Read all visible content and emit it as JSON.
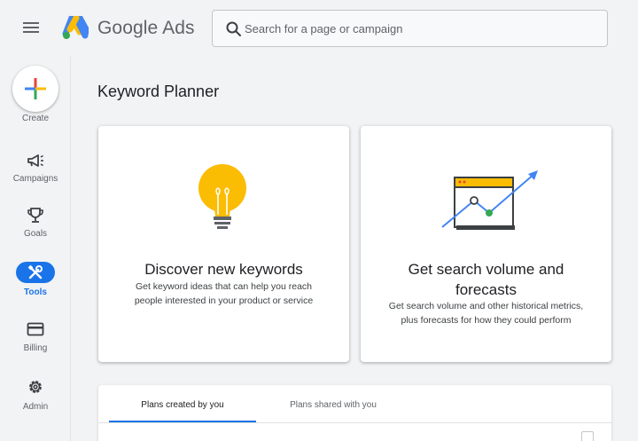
{
  "header": {
    "brand": "Google Ads",
    "search_placeholder": "Search for a page or campaign"
  },
  "sidebar": {
    "items": [
      {
        "label": "Create",
        "icon": "plus-icon"
      },
      {
        "label": "Campaigns",
        "icon": "megaphone-icon"
      },
      {
        "label": "Goals",
        "icon": "trophy-icon"
      },
      {
        "label": "Tools",
        "icon": "tools-icon",
        "active": true
      },
      {
        "label": "Billing",
        "icon": "credit-card-icon"
      },
      {
        "label": "Admin",
        "icon": "gear-icon"
      }
    ]
  },
  "main": {
    "title": "Keyword Planner",
    "cards": [
      {
        "title": "Discover new keywords",
        "desc_line1": "Get keyword ideas that can help you reach",
        "desc_line2": "people interested in your product or service",
        "icon": "lightbulb-icon"
      },
      {
        "title_line1": "Get search volume and",
        "title_line2": "forecasts",
        "desc_line1": "Get search volume and other historical metrics,",
        "desc_line2": "plus forecasts for how they could perform",
        "icon": "forecast-chart-icon"
      }
    ],
    "tabs": [
      {
        "label": "Plans created by you",
        "active": true
      },
      {
        "label": "Plans shared with you"
      }
    ]
  },
  "colors": {
    "accent": "#1a73e8",
    "background": "#f1f3f4",
    "bulb": "#fbbc04",
    "green": "#34a853",
    "red": "#ea4335"
  }
}
